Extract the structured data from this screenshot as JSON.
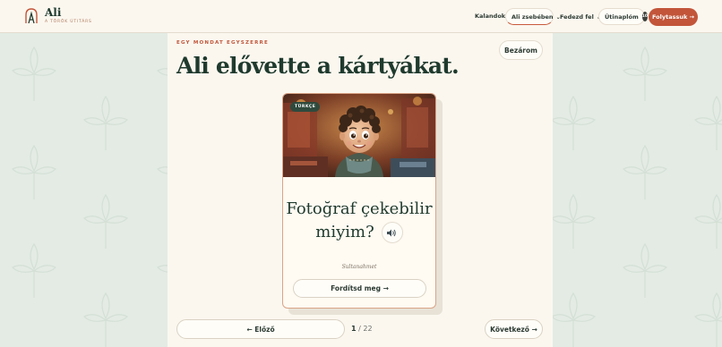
{
  "brand": {
    "name": "Ali",
    "tagline": "A TÖRÖK ÚTITÁRS"
  },
  "nav": {
    "items": [
      "Kalandok",
      "Ali zsebében",
      "Fedezd fel",
      "Útinaplóm"
    ],
    "journal_count": "10",
    "cta_label": "Folytassuk →"
  },
  "lesson": {
    "eyebrow": "EGY MONDAT EGYSZERRE",
    "title": "Ali elővette a kártyákat.",
    "close_label": "Bezárom"
  },
  "card": {
    "language_badge": "TÜRKÇE",
    "phrase_line1": "Fotoğraf çekebilir",
    "phrase_line2": "miyim?",
    "pronunciation": "Sultanahmet",
    "translate_label": "Fordítsd meg →"
  },
  "pager": {
    "prev_label": "← Előző",
    "current": "1",
    "separator": " / ",
    "total": "22",
    "next_label": "Következő →"
  },
  "colors": {
    "accent": "#c2553a",
    "brand_green": "#1f3a2e",
    "background": "#e3ebe4",
    "panel": "#fbf7ef"
  },
  "icons": [
    "logo-mark-icon",
    "chevron-down-icon",
    "arrow-right-icon",
    "speaker-icon",
    "clover-pattern-icon"
  ]
}
